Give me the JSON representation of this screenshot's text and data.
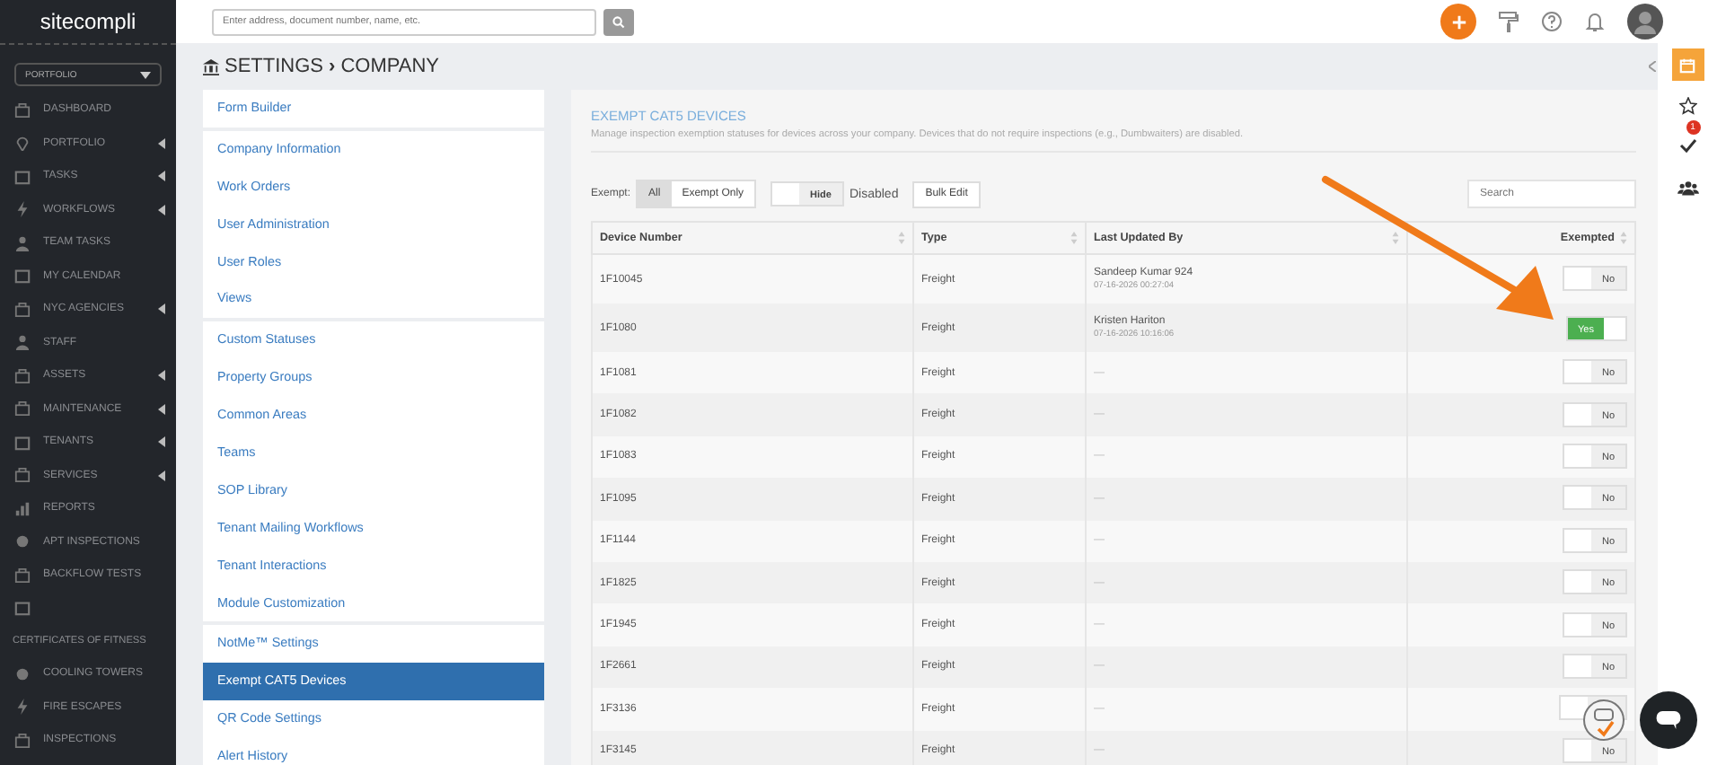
{
  "sidebar": {
    "logo": "sitecompli",
    "portfolio_select": "PORTFOLIO",
    "items": [
      {
        "kind": "item",
        "label": "DASHBOARD",
        "expandable": false
      },
      {
        "kind": "item",
        "label": "PORTFOLIO",
        "expandable": true
      },
      {
        "kind": "item",
        "label": "TASKS",
        "expandable": true
      },
      {
        "kind": "item",
        "label": "WORKFLOWS",
        "expandable": true
      },
      {
        "kind": "item",
        "label": "TEAM TASKS",
        "expandable": false
      },
      {
        "kind": "item",
        "label": "MY CALENDAR",
        "expandable": false
      },
      {
        "kind": "item",
        "label": "NYC AGENCIES",
        "expandable": true
      },
      {
        "kind": "item",
        "label": "STAFF",
        "expandable": false
      },
      {
        "kind": "item",
        "label": "ASSETS",
        "expandable": true
      },
      {
        "kind": "item",
        "label": "MAINTENANCE",
        "expandable": true
      },
      {
        "kind": "item",
        "label": "TENANTS",
        "expandable": true
      },
      {
        "kind": "item",
        "label": "SERVICES",
        "expandable": true
      },
      {
        "kind": "item",
        "label": "REPORTS",
        "expandable": false
      },
      {
        "kind": "item",
        "label": "APT INSPECTIONS",
        "expandable": false
      },
      {
        "kind": "item",
        "label": "BACKFLOW TESTS",
        "expandable": false
      },
      {
        "kind": "icon_only"
      },
      {
        "kind": "heading",
        "label": "CERTIFICATES OF FITNESS"
      },
      {
        "kind": "item",
        "label": "COOLING TOWERS",
        "expandable": false
      },
      {
        "kind": "item",
        "label": "FIRE ESCAPES",
        "expandable": false
      },
      {
        "kind": "item",
        "label": "INSPECTIONS",
        "expandable": false
      }
    ]
  },
  "topbar": {
    "search_placeholder": "Enter address, document number, name, etc."
  },
  "breadcrumb": {
    "section": "SETTINGS",
    "separator": "›",
    "page": "COMPANY"
  },
  "settings_menu": [
    [
      {
        "label": "Form Builder",
        "selected": false
      }
    ],
    [
      {
        "label": "Company Information",
        "selected": false
      },
      {
        "label": "Work Orders",
        "selected": false
      },
      {
        "label": "User Administration",
        "selected": false
      },
      {
        "label": "User Roles",
        "selected": false
      },
      {
        "label": "Views",
        "selected": false
      }
    ],
    [
      {
        "label": "Custom Statuses",
        "selected": false
      },
      {
        "label": "Property Groups",
        "selected": false
      },
      {
        "label": "Common Areas",
        "selected": false
      },
      {
        "label": "Teams",
        "selected": false
      },
      {
        "label": "SOP Library",
        "selected": false
      },
      {
        "label": "Tenant Mailing Workflows",
        "selected": false
      },
      {
        "label": "Tenant Interactions",
        "selected": false
      },
      {
        "label": "Module Customization",
        "selected": false
      }
    ],
    [
      {
        "label": "NotMe™ Settings",
        "selected": false
      },
      {
        "label": "Exempt CAT5 Devices",
        "selected": true
      },
      {
        "label": "QR Code Settings",
        "selected": false
      },
      {
        "label": "Alert History",
        "selected": false
      }
    ]
  ],
  "panel": {
    "title": "EXEMPT CAT5 DEVICES",
    "description": "Manage inspection exemption statuses for devices across your company. Devices that do not require inspections (e.g., Dumbwaiters) are disabled.",
    "filter_label": "Exempt:",
    "filters": [
      {
        "label": "All",
        "selected": true
      },
      {
        "label": "Exempt Only",
        "selected": false
      }
    ],
    "hide_toggle": {
      "label": "Hide",
      "on": false
    },
    "hide_caption": "Disabled",
    "bulk_edit": "Bulk Edit",
    "search_placeholder": "Search"
  },
  "table": {
    "columns": [
      "Device Number",
      "Type",
      "Last Updated By",
      "Exempted"
    ],
    "rows": [
      {
        "device": "1F10045",
        "type": "Freight",
        "updated_by": "Sandeep Kumar 924",
        "updated_at": "07-16-2026 00:27:04",
        "exempted": false,
        "toggle_label": "No"
      },
      {
        "device": "1F1080",
        "type": "Freight",
        "updated_by": "Kristen Hariton",
        "updated_at": "07-16-2026 10:16:06",
        "exempted": true,
        "toggle_label": "Yes"
      },
      {
        "device": "1F1081",
        "type": "Freight",
        "updated_by": "—",
        "exempted": false,
        "toggle_label": "No"
      },
      {
        "device": "1F1082",
        "type": "Freight",
        "updated_by": "—",
        "exempted": false,
        "toggle_label": "No"
      },
      {
        "device": "1F1083",
        "type": "Freight",
        "updated_by": "—",
        "exempted": false,
        "toggle_label": "No"
      },
      {
        "device": "1F1095",
        "type": "Freight",
        "updated_by": "—",
        "exempted": false,
        "toggle_label": "No"
      },
      {
        "device": "1F1144",
        "type": "Freight",
        "updated_by": "—",
        "exempted": false,
        "toggle_label": "No"
      },
      {
        "device": "1F1825",
        "type": "Freight",
        "updated_by": "—",
        "exempted": false,
        "toggle_label": "No"
      },
      {
        "device": "1F1945",
        "type": "Freight",
        "updated_by": "—",
        "exempted": false,
        "toggle_label": "No"
      },
      {
        "device": "1F2661",
        "type": "Freight",
        "updated_by": "—",
        "exempted": false,
        "toggle_label": "No"
      },
      {
        "device": "1F3136",
        "type": "Freight",
        "updated_by": "—",
        "exempted": false
      },
      {
        "device": "1F3145",
        "type": "Freight",
        "updated_by": "—",
        "exempted": false,
        "toggle_label": "No"
      }
    ]
  },
  "right_rail": {
    "task_badge": "1"
  }
}
